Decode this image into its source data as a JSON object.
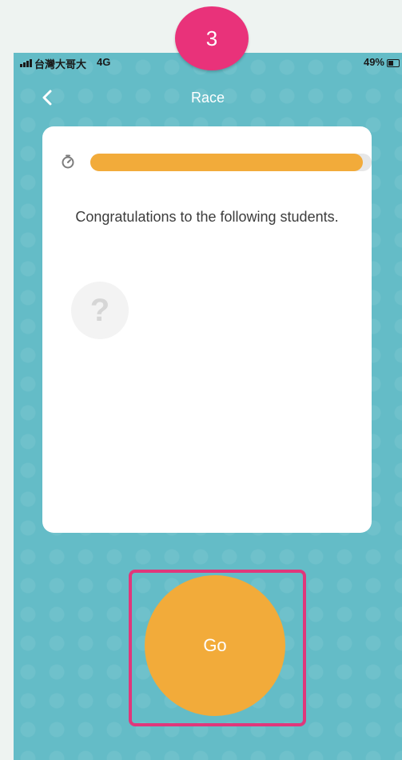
{
  "status_bar": {
    "carrier": "台灣大哥大",
    "network": "4G",
    "battery": "49%"
  },
  "nav": {
    "title": "Race",
    "back_icon": "chevron-left-icon"
  },
  "card": {
    "timer_icon": "stopwatch-icon",
    "timer_progress": 0.97,
    "message": "Congratulations to the following students.",
    "placeholder_symbol": "?"
  },
  "go_button": {
    "label": "Go"
  },
  "step_badge": {
    "number": "3"
  },
  "colors": {
    "background": "#64bcc7",
    "accent_orange": "#f2ab3a",
    "highlight_pink": "#e0377b"
  }
}
